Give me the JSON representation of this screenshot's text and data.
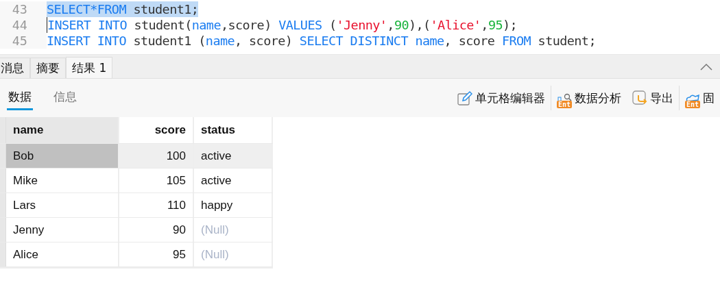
{
  "editor": {
    "lines": [
      {
        "number": "43",
        "selected": true,
        "caret": false,
        "tokens": [
          {
            "kind": "keyword",
            "text": "SELECT*FROM"
          },
          {
            "kind": "plain",
            "text": " student1;"
          }
        ]
      },
      {
        "number": "44",
        "selected": false,
        "caret": true,
        "tokens": [
          {
            "kind": "keyword",
            "text": "INSERT INTO"
          },
          {
            "kind": "plain",
            "text": " student("
          },
          {
            "kind": "keyword",
            "text": "name"
          },
          {
            "kind": "plain",
            "text": ",score) "
          },
          {
            "kind": "keyword",
            "text": "VALUES"
          },
          {
            "kind": "plain",
            "text": " ("
          },
          {
            "kind": "string",
            "text": "'Jenny'"
          },
          {
            "kind": "plain",
            "text": ","
          },
          {
            "kind": "number",
            "text": "90"
          },
          {
            "kind": "plain",
            "text": "),("
          },
          {
            "kind": "string",
            "text": "'Alice'"
          },
          {
            "kind": "plain",
            "text": ","
          },
          {
            "kind": "number",
            "text": "95"
          },
          {
            "kind": "plain",
            "text": ");"
          }
        ]
      },
      {
        "number": "45",
        "selected": false,
        "caret": false,
        "tokens": [
          {
            "kind": "keyword",
            "text": "INSERT INTO"
          },
          {
            "kind": "plain",
            "text": " student1 ("
          },
          {
            "kind": "keyword",
            "text": "name"
          },
          {
            "kind": "plain",
            "text": ", score) "
          },
          {
            "kind": "keyword",
            "text": "SELECT DISTINCT "
          },
          {
            "kind": "keyword",
            "text": "name"
          },
          {
            "kind": "plain",
            "text": ", score "
          },
          {
            "kind": "keyword",
            "text": "FROM"
          },
          {
            "kind": "plain",
            "text": " student;"
          }
        ]
      }
    ]
  },
  "tabs": [
    {
      "label": "消息",
      "selected": false
    },
    {
      "label": "摘要",
      "selected": false
    },
    {
      "label": "结果 1",
      "selected": true
    }
  ],
  "subtabs": [
    {
      "label": "数据",
      "selected": true
    },
    {
      "label": "信息",
      "selected": false
    }
  ],
  "toolbar": [
    {
      "kind": "edit",
      "label": "单元格编辑器"
    },
    {
      "kind": "analysis",
      "label": "数据分析",
      "badge": "Ent"
    },
    {
      "kind": "export",
      "label": "导出"
    },
    {
      "kind": "pin",
      "label": "固",
      "badge": "Ent"
    }
  ],
  "table": {
    "columns": [
      "name",
      "score",
      "status"
    ],
    "rows": [
      {
        "selected": true,
        "cells": [
          {
            "text": "Bob",
            "selected": true,
            "null": false
          },
          {
            "text": "100",
            "selected": false,
            "null": false
          },
          {
            "text": "active",
            "selected": false,
            "null": false
          }
        ]
      },
      {
        "selected": false,
        "cells": [
          {
            "text": "Mike",
            "selected": false,
            "null": false
          },
          {
            "text": "105",
            "selected": false,
            "null": false
          },
          {
            "text": "active",
            "selected": false,
            "null": false
          }
        ]
      },
      {
        "selected": false,
        "cells": [
          {
            "text": "Lars",
            "selected": false,
            "null": false
          },
          {
            "text": "110",
            "selected": false,
            "null": false
          },
          {
            "text": "happy",
            "selected": false,
            "null": false
          }
        ]
      },
      {
        "selected": false,
        "cells": [
          {
            "text": "Jenny",
            "selected": false,
            "null": false
          },
          {
            "text": "90",
            "selected": false,
            "null": false
          },
          {
            "text": "(Null)",
            "selected": false,
            "null": true
          }
        ]
      },
      {
        "selected": false,
        "cells": [
          {
            "text": "Alice",
            "selected": false,
            "null": false
          },
          {
            "text": "95",
            "selected": false,
            "null": false
          },
          {
            "text": "(Null)",
            "selected": false,
            "null": true
          }
        ]
      }
    ]
  }
}
